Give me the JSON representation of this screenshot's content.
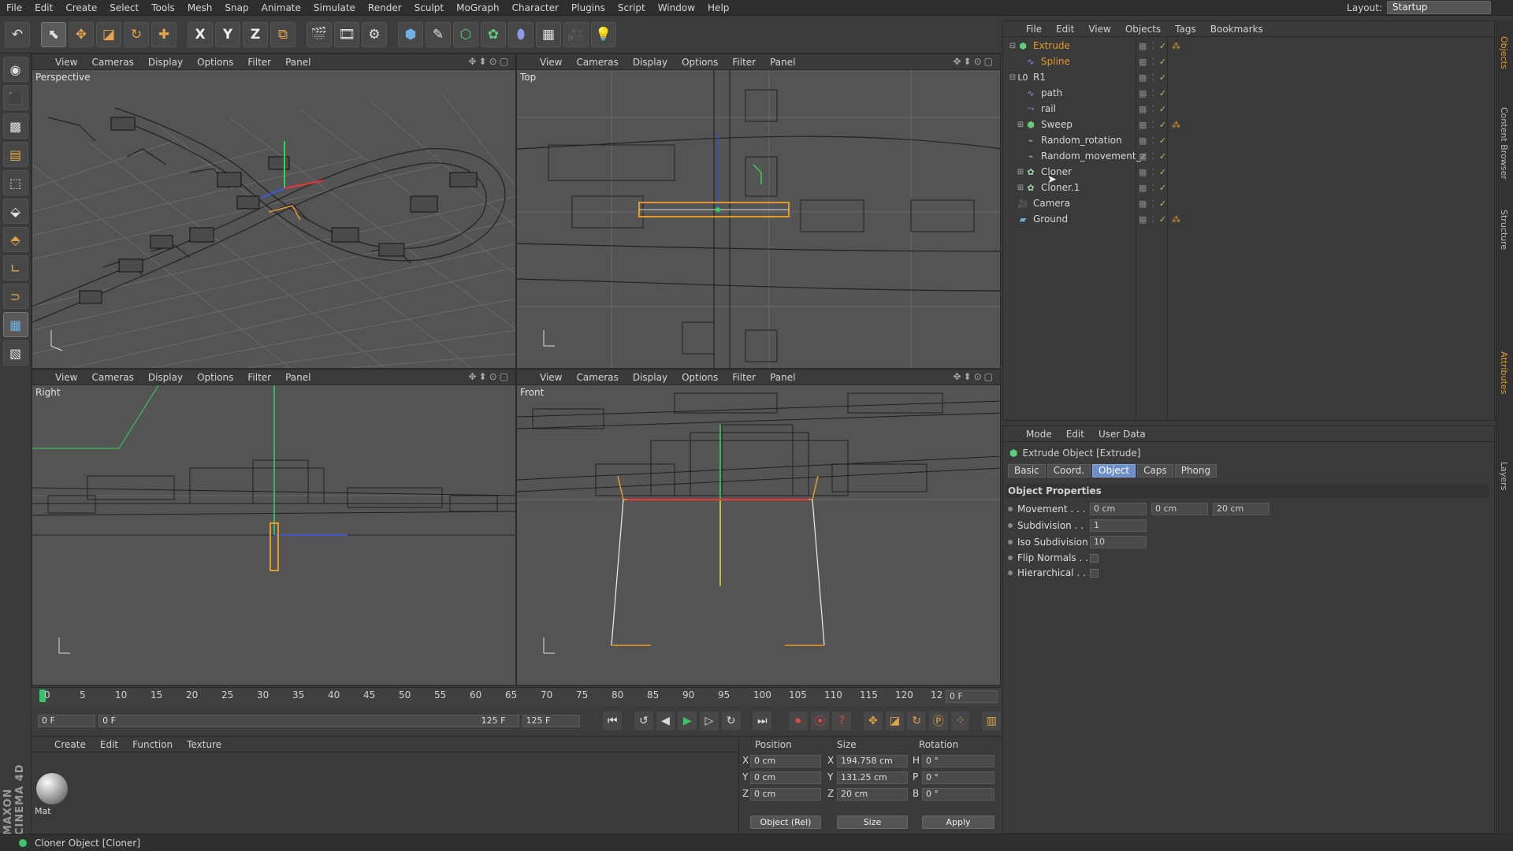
{
  "menu": [
    "File",
    "Edit",
    "Create",
    "Select",
    "Tools",
    "Mesh",
    "Snap",
    "Animate",
    "Simulate",
    "Render",
    "Sculpt",
    "MoGraph",
    "Character",
    "Plugins",
    "Script",
    "Window",
    "Help"
  ],
  "layout": {
    "label": "Layout:",
    "value": "Startup"
  },
  "viewport_menu": [
    "View",
    "Cameras",
    "Display",
    "Options",
    "Filter",
    "Panel"
  ],
  "viewports": [
    {
      "name": "Perspective"
    },
    {
      "name": "Top"
    },
    {
      "name": "Right"
    },
    {
      "name": "Front"
    }
  ],
  "toolbar_icons": [
    "undo-icon",
    "select-icon",
    "move-icon",
    "scale-icon",
    "rotate-icon",
    "add-icon",
    "x-axis-icon",
    "y-axis-icon",
    "z-axis-icon",
    "coord-system-icon",
    "render-view-icon",
    "render-picture-icon",
    "render-settings-icon",
    "cube-icon",
    "pen-icon",
    "subdivision-icon",
    "array-icon",
    "deformer-icon",
    "floor-icon",
    "camera-icon",
    "light-icon"
  ],
  "axis_letters": {
    "x": "X",
    "y": "Y",
    "z": "Z"
  },
  "timeline": {
    "ticks": [
      "0",
      "5",
      "10",
      "15",
      "20",
      "25",
      "30",
      "35",
      "40",
      "45",
      "50",
      "55",
      "60",
      "65",
      "70",
      "75",
      "80",
      "85",
      "90",
      "95",
      "100",
      "105",
      "110",
      "115",
      "120",
      "12"
    ],
    "current": "0 F",
    "start": "0 F",
    "range_start": "0 F",
    "range_end": "125 F",
    "end": "125 F"
  },
  "material_manager": {
    "menu": [
      "Create",
      "Edit",
      "Function",
      "Texture"
    ],
    "material": "Mat"
  },
  "coordinates": {
    "headers": {
      "position": "Position",
      "size": "Size",
      "rotation": "Rotation"
    },
    "rows": [
      {
        "axis": "X",
        "pos": "0 cm",
        "size_axis": "X",
        "size": "194.758 cm",
        "rot_axis": "H",
        "rot": "0 °"
      },
      {
        "axis": "Y",
        "pos": "0 cm",
        "size_axis": "Y",
        "size": "131.25 cm",
        "rot_axis": "P",
        "rot": "0 °"
      },
      {
        "axis": "Z",
        "pos": "0 cm",
        "size_axis": "Z",
        "size": "20 cm",
        "rot_axis": "B",
        "rot": "0 °"
      }
    ],
    "mode": "Object (Rel)",
    "size_mode": "Size",
    "apply": "Apply"
  },
  "object_manager": {
    "menu": [
      "File",
      "Edit",
      "View",
      "Objects",
      "Tags",
      "Bookmarks"
    ],
    "objects": [
      {
        "name": "Extrude",
        "color": "#e39a2b",
        "icon": "extrude-icon",
        "indent": 0,
        "exp": "⊟",
        "tag": true
      },
      {
        "name": "Spline",
        "color": "#e39a2b",
        "icon": "spline-icon",
        "indent": 1,
        "exp": "",
        "tag": false
      },
      {
        "name": "R1",
        "color": "#d6d6d6",
        "icon": "null-icon",
        "indent": 0,
        "exp": "⊟",
        "tag": false
      },
      {
        "name": "path",
        "color": "#d6d6d6",
        "icon": "spline-icon",
        "indent": 1,
        "exp": "",
        "tag": false
      },
      {
        "name": "rail",
        "color": "#d6d6d6",
        "icon": "rail-icon",
        "indent": 1,
        "exp": "",
        "tag": false
      },
      {
        "name": "Sweep",
        "color": "#d6d6d6",
        "icon": "sweep-icon",
        "indent": 1,
        "exp": "⊞",
        "tag": true
      },
      {
        "name": "Random_rotation",
        "color": "#d6d6d6",
        "icon": "effector-icon",
        "indent": 1,
        "exp": "",
        "tag": false
      },
      {
        "name": "Random_movement_z",
        "color": "#d6d6d6",
        "icon": "effector-icon",
        "indent": 1,
        "exp": "",
        "tag": false
      },
      {
        "name": "Cloner",
        "color": "#d6d6d6",
        "icon": "cloner-icon",
        "indent": 1,
        "exp": "⊞",
        "tag": false
      },
      {
        "name": "Cloner.1",
        "color": "#d6d6d6",
        "icon": "cloner-icon",
        "indent": 1,
        "exp": "⊞",
        "tag": false
      },
      {
        "name": "Camera",
        "color": "#d6d6d6",
        "icon": "camera-icon",
        "indent": 0,
        "exp": "",
        "tag": false
      },
      {
        "name": "Ground",
        "color": "#d6d6d6",
        "icon": "floor-icon",
        "indent": 0,
        "exp": "",
        "tag": true
      }
    ]
  },
  "attributes": {
    "menu": [
      "Mode",
      "Edit",
      "User Data"
    ],
    "title": "Extrude Object [Extrude]",
    "tabs": [
      {
        "label": "Basic",
        "active": false
      },
      {
        "label": "Coord.",
        "active": false
      },
      {
        "label": "Object",
        "active": true
      },
      {
        "label": "Caps",
        "active": false
      },
      {
        "label": "Phong",
        "active": false
      }
    ],
    "section": "Object Properties",
    "movement": {
      "label": "Movement . . .",
      "x": "0 cm",
      "y": "0 cm",
      "z": "20 cm"
    },
    "subdivision": {
      "label": "Subdivision . .",
      "value": "1"
    },
    "iso": {
      "label": "Iso Subdivision",
      "value": "10"
    },
    "flip": {
      "label": "Flip Normals . ."
    },
    "hier": {
      "label": "Hierarchical . ."
    }
  },
  "side_tabs": [
    "Objects",
    "Content Browser",
    "Structure",
    "Attributes",
    "Layers"
  ],
  "status": "Cloner Object [Cloner]",
  "brand": "MAXON CINEMA 4D"
}
